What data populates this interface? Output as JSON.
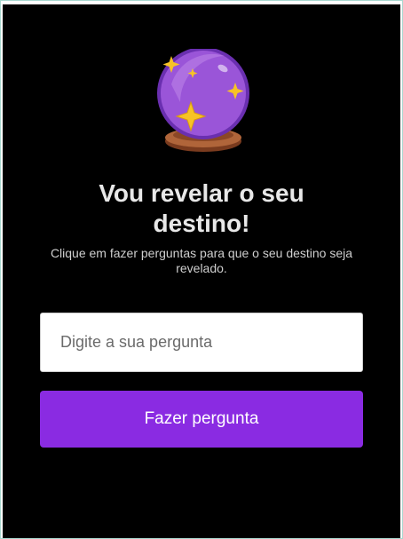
{
  "header": {
    "icon": "crystal-ball-icon",
    "title": "Vou revelar o seu destino!",
    "subtitle": "Clique em fazer perguntas para que o seu destino seja revelado."
  },
  "form": {
    "question_placeholder": "Digite a sua pergunta",
    "question_value": "",
    "submit_label": "Fazer pergunta"
  },
  "colors": {
    "background": "#000000",
    "accent": "#8a2be2",
    "title_text": "#e8e8e8",
    "orb": "#9b59d6",
    "sparkle": "#f5c518",
    "base": "#a0522d"
  }
}
